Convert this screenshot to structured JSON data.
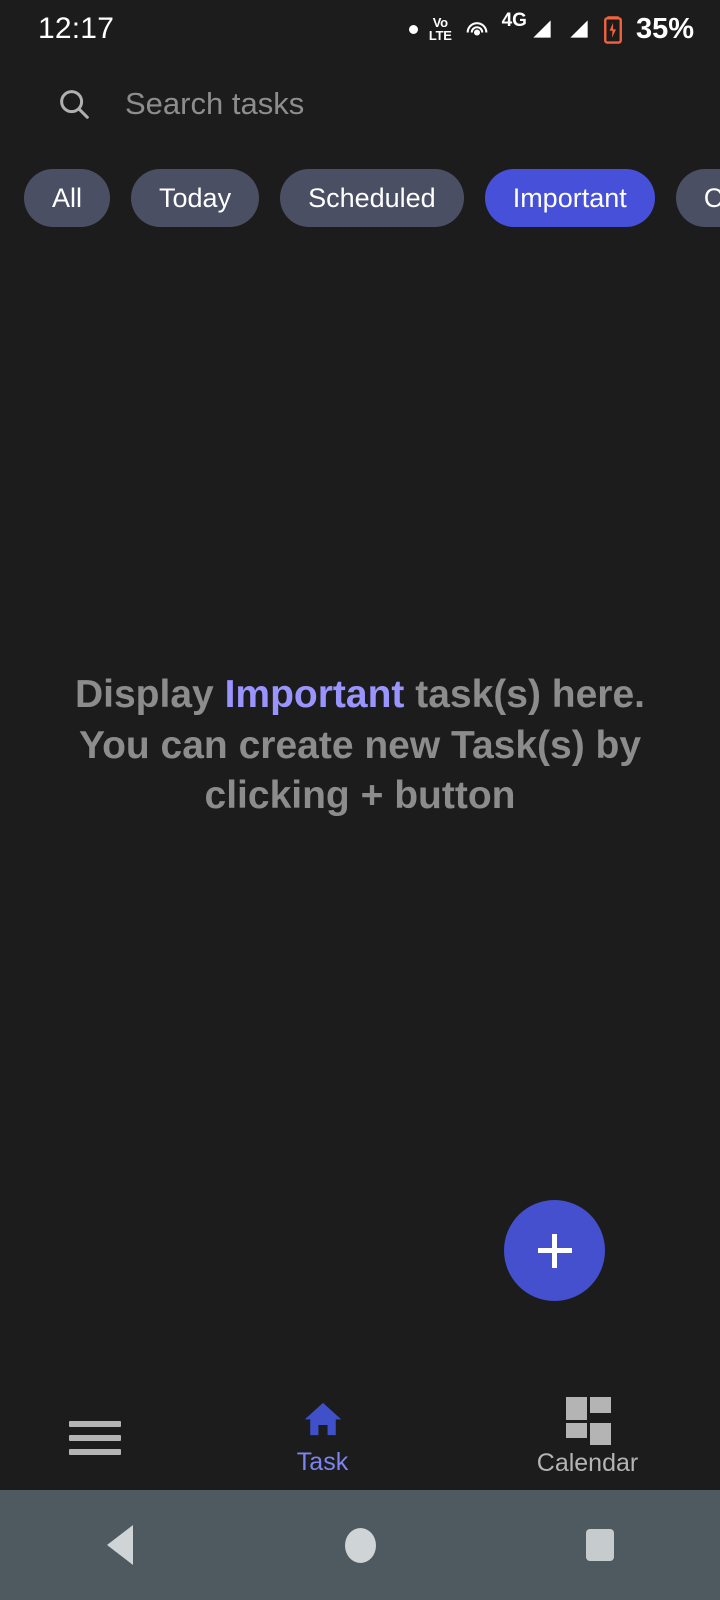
{
  "status_bar": {
    "time": "12:17",
    "battery_percent": "35%",
    "network_label": "4G",
    "volte_top": "Vo",
    "volte_bottom": "LTE",
    "icons": [
      "dot-icon",
      "volte-icon",
      "hotspot-icon",
      "signal-4g-icon",
      "signal-bars-icon",
      "battery-charging-icon"
    ]
  },
  "search": {
    "placeholder": "Search tasks",
    "value": "",
    "icon": "search-icon"
  },
  "filters": {
    "selected": "Important",
    "chips": [
      {
        "label": "All",
        "selected": false
      },
      {
        "label": "Today",
        "selected": false
      },
      {
        "label": "Scheduled",
        "selected": false
      },
      {
        "label": "Important",
        "selected": true
      },
      {
        "label": "Completed",
        "selected": false
      }
    ]
  },
  "empty_state": {
    "line1_before": "Display ",
    "line1_highlight": "Important",
    "line1_after": " task(s) here.",
    "line2": "You can create new Task(s) by",
    "line3": "clicking + button"
  },
  "fab": {
    "label": "+",
    "name": "add-task-button"
  },
  "bottom_nav": {
    "items": [
      {
        "label": "",
        "icon": "hamburger-menu-icon",
        "active": false,
        "name": "menu"
      },
      {
        "label": "Task",
        "icon": "home-icon",
        "active": true,
        "name": "task"
      },
      {
        "label": "Calendar",
        "icon": "grid-dashboard-icon",
        "active": false,
        "name": "calendar"
      }
    ]
  },
  "system_nav": {
    "back": "back-icon",
    "home": "home-circle-icon",
    "recents": "recents-icon"
  },
  "colors": {
    "background": "#1c1c1c",
    "accent": "#4750d8",
    "accent_light": "#9a94ff",
    "chip_inactive": "#4a4f63",
    "fab": "#4450ce",
    "sysnav": "#4e5a60",
    "battery": "#f4643c",
    "muted_text": "#8c8c8c"
  }
}
